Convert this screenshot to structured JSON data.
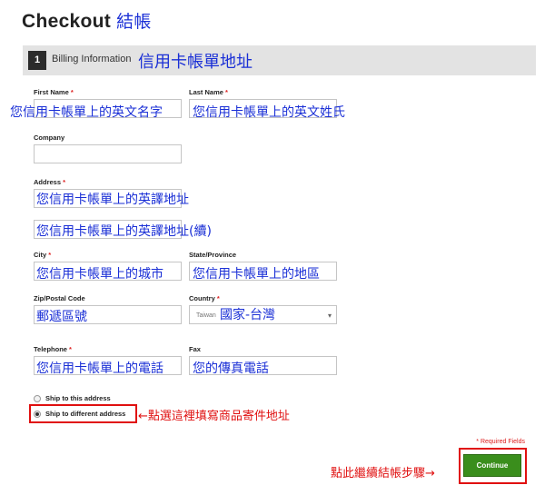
{
  "page": {
    "title": "Checkout",
    "title_note": "結帳"
  },
  "section": {
    "step": "1",
    "label": "Billing Information",
    "note": "信用卡帳單地址"
  },
  "form": {
    "first_name": {
      "label": "First Name",
      "required": "*",
      "value": "您信用卡帳單上的英文名字"
    },
    "last_name": {
      "label": "Last Name",
      "required": "*",
      "value": "您信用卡帳單上的英文姓氏"
    },
    "company": {
      "label": "Company",
      "value": ""
    },
    "address": {
      "label": "Address",
      "required": "*",
      "value": "您信用卡帳單上的英譯地址",
      "value2": "您信用卡帳單上的英譯地址(續)"
    },
    "city": {
      "label": "City",
      "required": "*",
      "value": "您信用卡帳單上的城市"
    },
    "state": {
      "label": "State/Province",
      "value": "您信用卡帳單上的地區"
    },
    "zip": {
      "label": "Zip/Postal Code",
      "value": "郵遞區號"
    },
    "country": {
      "label": "Country",
      "required": "*",
      "selected": "Taiwan",
      "note": "國家-台灣"
    },
    "telephone": {
      "label": "Telephone",
      "required": "*",
      "value": "您信用卡帳單上的電話"
    },
    "fax": {
      "label": "Fax",
      "value": "您的傳真電話"
    }
  },
  "shipping": {
    "option_same": "Ship to this address",
    "option_different": "Ship to different address",
    "note": "←點選這裡填寫商品寄件地址"
  },
  "footer": {
    "required_note": "* Required Fields",
    "continue_label": "Continue",
    "continue_note": "點此繼續結帳步驟→"
  },
  "colors": {
    "annotation_blue": "#1a2fd6",
    "annotation_red": "#e01010",
    "button_green": "#3a8e1c"
  }
}
